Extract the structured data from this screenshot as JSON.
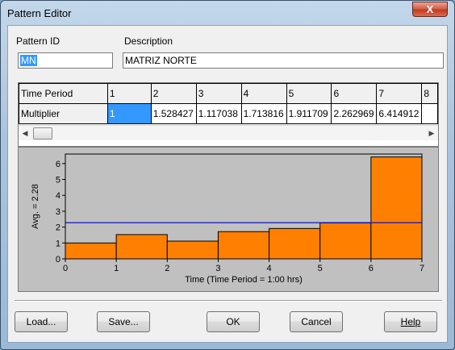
{
  "window": {
    "title": "Pattern Editor",
    "close_label": "X"
  },
  "pattern": {
    "id_label": "Pattern ID",
    "id_value": "MN",
    "description_label": "Description",
    "description_value": "MATRIZ NORTE"
  },
  "grid": {
    "row_labels": [
      "Time Period",
      "Multiplier"
    ],
    "periods": [
      "1",
      "2",
      "3",
      "4",
      "5",
      "6",
      "7",
      "8"
    ],
    "multipliers": [
      "1",
      "1.528427",
      "1.117038",
      "1.713816",
      "1.911709",
      "2.262969",
      "6.414912",
      ""
    ]
  },
  "chart_data": {
    "type": "bar",
    "x": [
      0,
      1,
      2,
      3,
      4,
      5,
      6,
      7
    ],
    "values": [
      1,
      1.528427,
      1.117038,
      1.713816,
      1.911709,
      2.262969,
      6.414912
    ],
    "average": 2.28,
    "ylabel": "Avg. = 2.28",
    "xlabel": "Time (Time Period = 1:00  hrs)",
    "xlim": [
      0,
      7
    ],
    "ylim": [
      0,
      6.6
    ],
    "xticks": [
      "0",
      "1",
      "2",
      "3",
      "4",
      "5",
      "6",
      "7"
    ],
    "yticks": [
      "0",
      "1",
      "2",
      "3",
      "4",
      "5",
      "6"
    ],
    "bar_color": "#ff8000",
    "avg_line_color": "#1010cc",
    "plot_bg": "#c0c0c0",
    "grid": false
  },
  "buttons": {
    "load": "Load...",
    "save": "Save...",
    "ok": "OK",
    "cancel": "Cancel",
    "help": "Help"
  }
}
